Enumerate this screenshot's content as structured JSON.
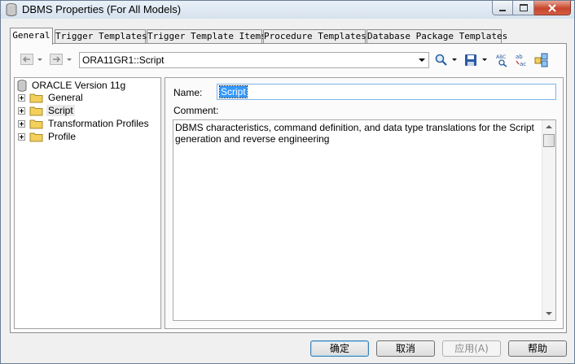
{
  "window": {
    "title": "DBMS Properties (For All Models)"
  },
  "tabs": [
    {
      "label": "General",
      "active": true
    },
    {
      "label": "Trigger Templates",
      "active": false
    },
    {
      "label": "Trigger Template Items",
      "active": false
    },
    {
      "label": "Procedure Templates",
      "active": false
    },
    {
      "label": "Database Package Templates",
      "active": false
    }
  ],
  "toolbar": {
    "path_value": "ORA11GR1::Script",
    "icons": [
      "back-arrow-icon",
      "forward-arrow-icon",
      "find-icon",
      "save-icon",
      "spell-check-icon",
      "replace-icon",
      "browse-icon"
    ]
  },
  "tree": {
    "root": {
      "label": "ORACLE Version 11g",
      "icon": "database-icon"
    },
    "items": [
      {
        "label": "General",
        "icon": "folder-icon"
      },
      {
        "label": "Script",
        "icon": "folder-icon",
        "selected": true
      },
      {
        "label": "Transformation Profiles",
        "icon": "folder-icon"
      },
      {
        "label": "Profile",
        "icon": "folder-icon"
      }
    ]
  },
  "properties": {
    "name_label": "Name:",
    "name_value": "Script",
    "comment_label": "Comment:",
    "comment_value": "DBMS characteristics, command definition, and data type translations for the Script generation and reverse engineering"
  },
  "buttons": {
    "ok": "确定",
    "cancel": "取消",
    "apply": "应用(A)",
    "help": "帮助"
  },
  "colors": {
    "selection": "#3399ff",
    "folder": "#f3cf5b",
    "close_button": "#c7462d"
  }
}
